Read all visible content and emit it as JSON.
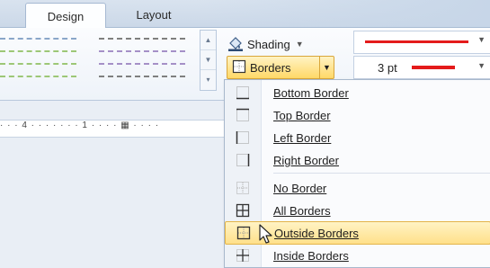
{
  "tabs": [
    {
      "label": "Design",
      "active": true
    },
    {
      "label": "Layout",
      "active": false
    }
  ],
  "ribbon": {
    "shading": {
      "label": "Shading",
      "icon": "paint-bucket-icon"
    },
    "borders": {
      "label": "Borders",
      "icon": "outside-borders-icon"
    },
    "pen_weight": "3 pt",
    "pen_color": "#e41b1b"
  },
  "ruler": {
    "text": "· · · 4 · · · · · · · 1 · · · · ▦ · · · ·"
  },
  "borders_menu": [
    {
      "label": "Bottom Border",
      "icon": "bottom-border-icon",
      "highlighted": false
    },
    {
      "label": "Top Border",
      "icon": "top-border-icon",
      "highlighted": false
    },
    {
      "label": "Left Border",
      "icon": "left-border-icon",
      "highlighted": false
    },
    {
      "label": "Right Border",
      "icon": "right-border-icon",
      "highlighted": false
    },
    {
      "label": "No Border",
      "icon": "no-border-icon",
      "highlighted": false
    },
    {
      "label": "All Borders",
      "icon": "all-borders-icon",
      "highlighted": false
    },
    {
      "label": "Outside Borders",
      "icon": "outside-borders-icon",
      "highlighted": true
    },
    {
      "label": "Inside Borders",
      "icon": "inside-borders-icon",
      "highlighted": false
    }
  ]
}
